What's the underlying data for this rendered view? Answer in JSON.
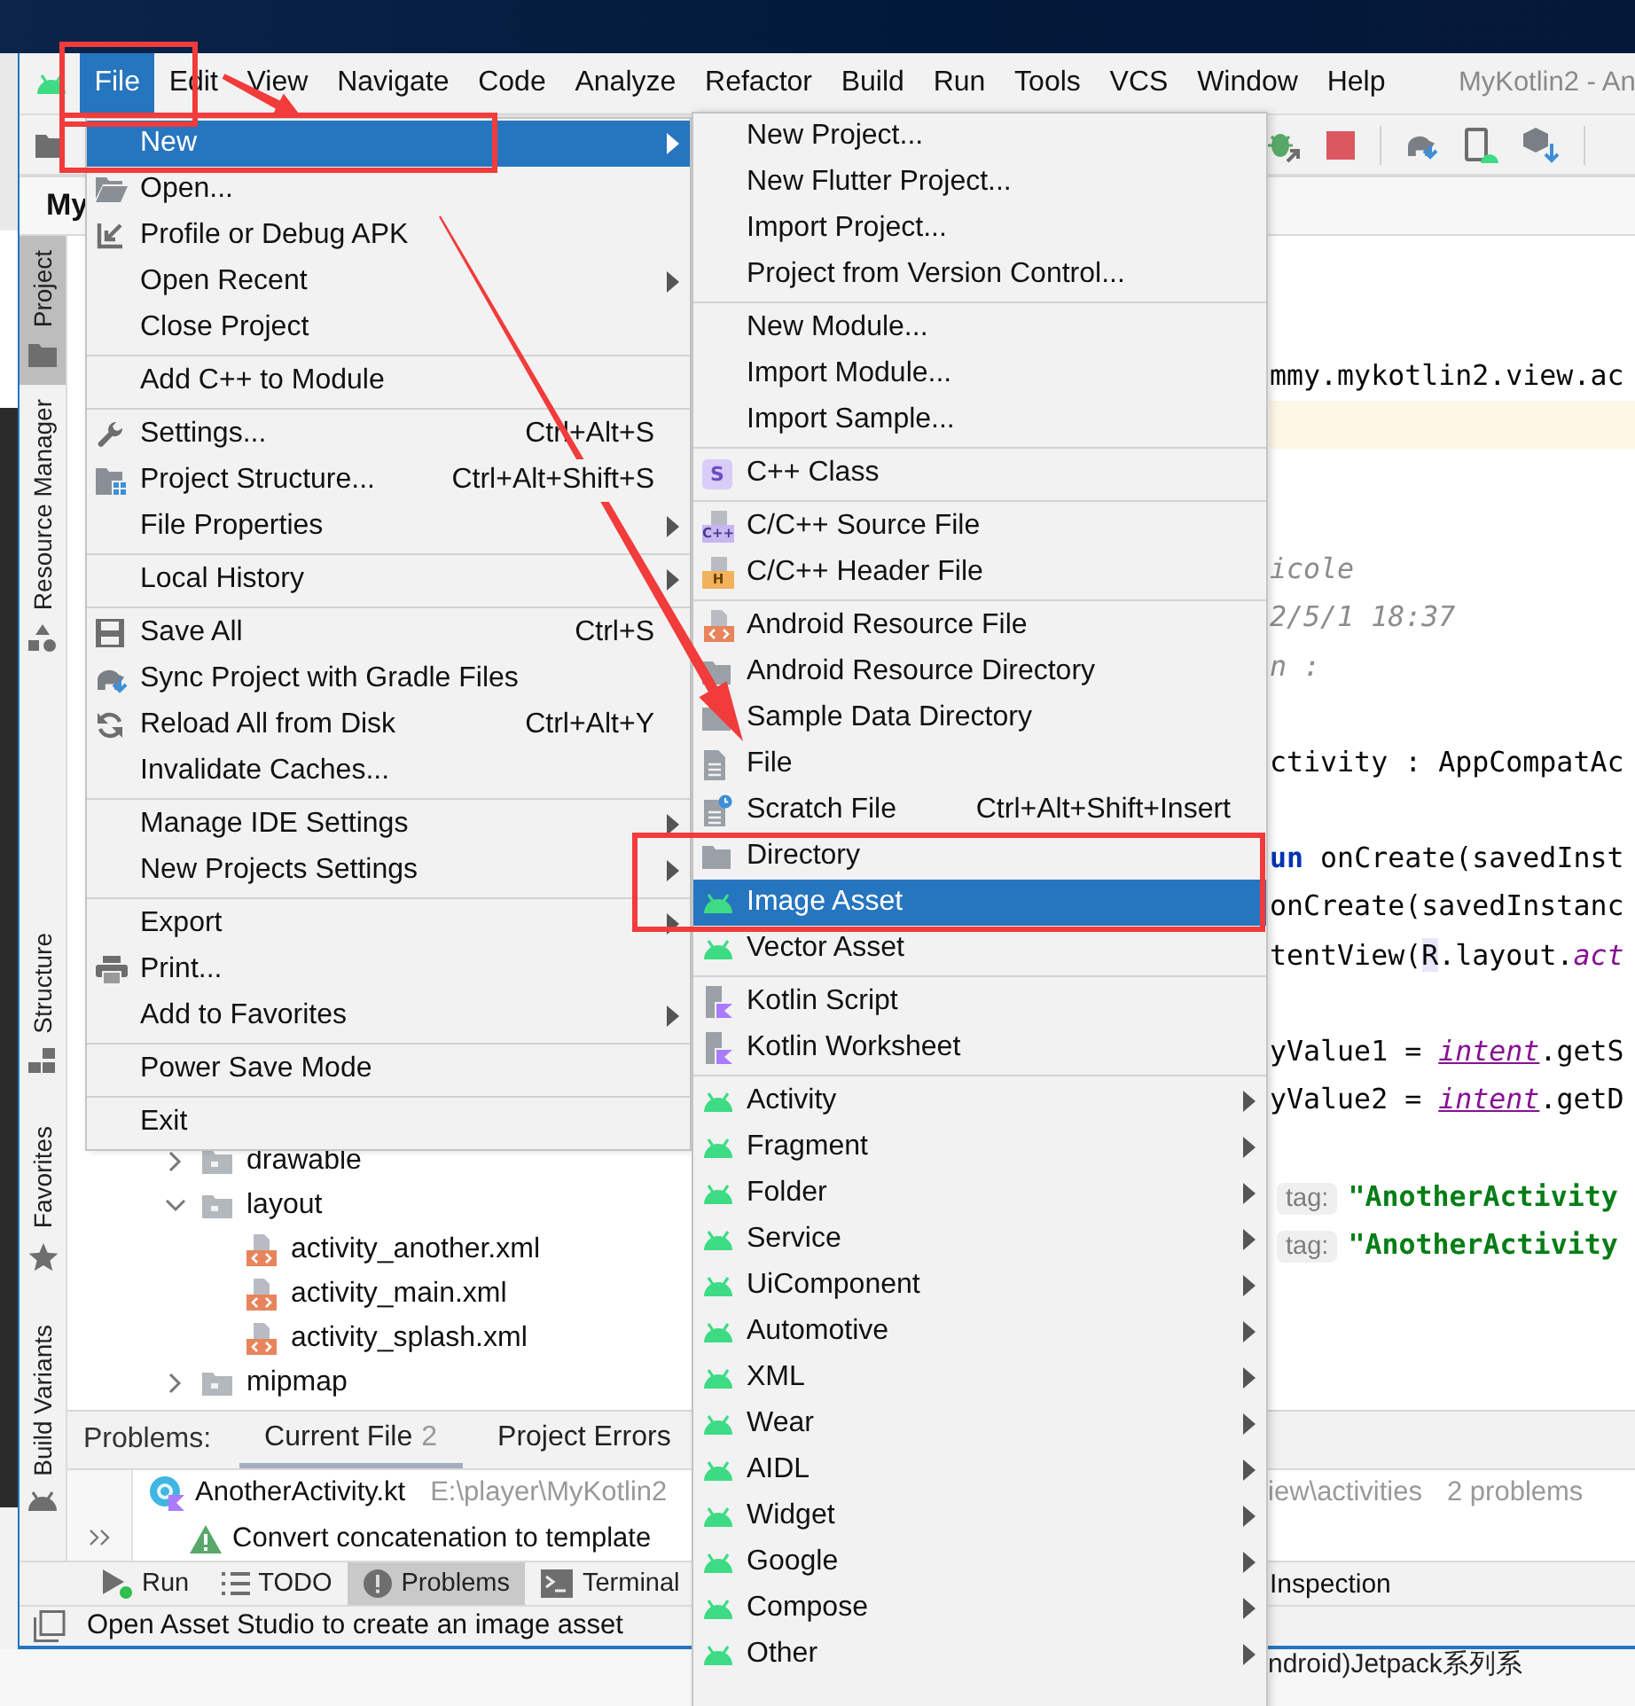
{
  "menubar": {
    "items": [
      {
        "label": "File",
        "selected": true
      },
      {
        "label": "Edit",
        "selected": false
      },
      {
        "label": "View",
        "selected": false
      },
      {
        "label": "Navigate",
        "selected": false
      },
      {
        "label": "Code",
        "selected": false
      },
      {
        "label": "Analyze",
        "selected": false
      },
      {
        "label": "Refactor",
        "selected": false
      },
      {
        "label": "Build",
        "selected": false
      },
      {
        "label": "Run",
        "selected": false
      },
      {
        "label": "Tools",
        "selected": false
      },
      {
        "label": "VCS",
        "selected": false
      },
      {
        "label": "Window",
        "selected": false
      },
      {
        "label": "Help",
        "selected": false
      }
    ],
    "title": "MyKotlin2 - An"
  },
  "project_panel": {
    "title": "My",
    "tree": [
      {
        "label": "drawable",
        "kind": "folder",
        "expanded": false
      },
      {
        "label": "layout",
        "kind": "folder",
        "expanded": true,
        "children": [
          {
            "label": "activity_another.xml",
            "kind": "xml"
          },
          {
            "label": "activity_main.xml",
            "kind": "xml"
          },
          {
            "label": "activity_splash.xml",
            "kind": "xml"
          }
        ]
      },
      {
        "label": "mipmap",
        "kind": "folder",
        "expanded": false
      }
    ]
  },
  "tool_stripe": {
    "top": [
      {
        "label": "Project",
        "kind": "folder",
        "selected": true
      },
      {
        "label": "Resource Manager",
        "kind": "shapes",
        "selected": false
      }
    ],
    "bottom": [
      {
        "label": "Structure",
        "kind": "blocks",
        "selected": false
      },
      {
        "label": "Favorites",
        "kind": "star",
        "selected": false
      },
      {
        "label": "Build Variants",
        "kind": "robot",
        "selected": false
      }
    ]
  },
  "editor": {
    "lines": [
      {
        "kind": "blank",
        "highlighted": false
      },
      {
        "kind": "blank",
        "highlighted": false
      },
      {
        "kind": "code",
        "highlighted": false,
        "segments": [
          {
            "text": "mmy.mykotlin2.view.ac",
            "kind": "plain"
          }
        ]
      },
      {
        "kind": "blank",
        "highlighted": true
      },
      {
        "kind": "blank",
        "highlighted": false
      },
      {
        "kind": "blank",
        "highlighted": false
      },
      {
        "kind": "code",
        "highlighted": false,
        "segments": [
          {
            "text": "icole",
            "kind": "comment"
          }
        ]
      },
      {
        "kind": "code",
        "highlighted": false,
        "segments": [
          {
            "text": "2/5/1 18:37",
            "kind": "comment"
          }
        ]
      },
      {
        "kind": "code",
        "highlighted": false,
        "segments": [
          {
            "text": "n :",
            "kind": "comment"
          }
        ]
      },
      {
        "kind": "blank",
        "highlighted": false
      },
      {
        "kind": "code",
        "highlighted": false,
        "segments": [
          {
            "text": "ctivity : AppCompatAc",
            "kind": "plain"
          }
        ]
      },
      {
        "kind": "blank",
        "highlighted": false
      },
      {
        "kind": "code",
        "highlighted": false,
        "segments": [
          {
            "text": "un",
            "kind": "keyword"
          },
          {
            "text": " onCreate(savedInst",
            "kind": "plain"
          }
        ]
      },
      {
        "kind": "code",
        "highlighted": false,
        "segments": [
          {
            "text": "onCreate(savedInstanc",
            "kind": "plain"
          }
        ]
      },
      {
        "kind": "code",
        "highlighted": false,
        "segments": [
          {
            "text": "tentView(",
            "kind": "plain"
          },
          {
            "text": "R",
            "kind": "symbol"
          },
          {
            "text": ".layout.",
            "kind": "plain"
          },
          {
            "text": "act",
            "kind": "field"
          }
        ]
      },
      {
        "kind": "blank",
        "highlighted": false
      },
      {
        "kind": "code",
        "highlighted": false,
        "segments": [
          {
            "text": "yValue1 = ",
            "kind": "plain"
          },
          {
            "text": "intent",
            "kind": "ref"
          },
          {
            "text": ".getS",
            "kind": "plain"
          }
        ]
      },
      {
        "kind": "code",
        "highlighted": false,
        "segments": [
          {
            "text": "yValue2 = ",
            "kind": "plain"
          },
          {
            "text": "intent",
            "kind": "ref"
          },
          {
            "text": ".getD",
            "kind": "plain"
          }
        ]
      },
      {
        "kind": "blank",
        "highlighted": false
      },
      {
        "kind": "code",
        "highlighted": false,
        "segments": [
          {
            "text": "tag:",
            "kind": "hint"
          },
          {
            "text": "\"AnotherActivity",
            "kind": "string"
          }
        ]
      },
      {
        "kind": "code",
        "highlighted": false,
        "segments": [
          {
            "text": "tag:",
            "kind": "hint"
          },
          {
            "text": "\"AnotherActivity",
            "kind": "string"
          }
        ]
      }
    ]
  },
  "problems": {
    "title": "Problems:",
    "tabs": [
      {
        "label": "Current File",
        "count": "2",
        "selected": true
      },
      {
        "label": "Project Errors",
        "selected": false
      }
    ],
    "file": {
      "name": "AnotherActivity.kt",
      "path": "E:\\player\\MyKotlin2",
      "path_tail": "iew\\activities",
      "summary": "2 problems"
    },
    "warning": "Convert concatenation to template"
  },
  "tool_windows": [
    {
      "label": "Run",
      "kind": "run",
      "selected": false
    },
    {
      "label": "TODO",
      "kind": "list",
      "selected": false
    },
    {
      "label": "Problems",
      "kind": "error",
      "selected": true
    },
    {
      "label": "Terminal",
      "kind": "terminal",
      "selected": false
    }
  ],
  "tool_windows_right": "Inspection",
  "status_bar": "Open Asset Studio to create an image asset",
  "background_text": "ndroid)Jetpack系列系",
  "file_menu": [
    {
      "kind": "plain",
      "label": "New",
      "submenu": true,
      "selected": true
    },
    {
      "kind": "open-folder",
      "label": "Open...",
      "submenu": false,
      "selected": false
    },
    {
      "kind": "corner-arrow",
      "label": "Profile or Debug APK",
      "submenu": false,
      "selected": false
    },
    {
      "kind": "plain",
      "label": "Open Recent",
      "submenu": true,
      "selected": false
    },
    {
      "kind": "plain",
      "label": "Close Project",
      "submenu": false,
      "selected": false
    },
    {
      "kind": "separator"
    },
    {
      "kind": "plain",
      "label": "Add C++ to Module",
      "submenu": false,
      "selected": false
    },
    {
      "kind": "separator"
    },
    {
      "kind": "wrench",
      "label": "Settings...",
      "shortcut": "Ctrl+Alt+S",
      "submenu": false,
      "selected": false
    },
    {
      "kind": "folder-grid",
      "label": "Project Structure...",
      "shortcut": "Ctrl+Alt+Shift+S",
      "submenu": false,
      "selected": false
    },
    {
      "kind": "plain",
      "label": "File Properties",
      "submenu": true,
      "selected": false
    },
    {
      "kind": "separator"
    },
    {
      "kind": "plain",
      "label": "Local History",
      "submenu": true,
      "selected": false
    },
    {
      "kind": "separator"
    },
    {
      "kind": "save",
      "label": "Save All",
      "shortcut": "Ctrl+S",
      "submenu": false,
      "selected": false
    },
    {
      "kind": "elephant",
      "label": "Sync Project with Gradle Files",
      "submenu": false,
      "selected": false
    },
    {
      "kind": "reload",
      "label": "Reload All from Disk",
      "shortcut": "Ctrl+Alt+Y",
      "submenu": false,
      "selected": false
    },
    {
      "kind": "plain",
      "label": "Invalidate Caches...",
      "submenu": false,
      "selected": false
    },
    {
      "kind": "separator"
    },
    {
      "kind": "plain",
      "label": "Manage IDE Settings",
      "submenu": true,
      "selected": false
    },
    {
      "kind": "plain",
      "label": "New Projects Settings",
      "submenu": true,
      "selected": false
    },
    {
      "kind": "separator"
    },
    {
      "kind": "plain",
      "label": "Export",
      "submenu": true,
      "selected": false
    },
    {
      "kind": "printer",
      "label": "Print...",
      "submenu": false,
      "selected": false
    },
    {
      "kind": "plain",
      "label": "Add to Favorites",
      "submenu": true,
      "selected": false
    },
    {
      "kind": "separator"
    },
    {
      "kind": "plain",
      "label": "Power Save Mode",
      "submenu": false,
      "selected": false
    },
    {
      "kind": "separator"
    },
    {
      "kind": "plain",
      "label": "Exit",
      "submenu": false,
      "selected": false
    }
  ],
  "new_submenu": [
    {
      "kind": "plain",
      "label": "New Project...",
      "submenu": false,
      "selected": false
    },
    {
      "kind": "plain",
      "label": "New Flutter Project...",
      "submenu": false,
      "selected": false
    },
    {
      "kind": "plain",
      "label": "Import Project...",
      "submenu": false,
      "selected": false
    },
    {
      "kind": "plain",
      "label": "Project from Version Control...",
      "submenu": false,
      "selected": false
    },
    {
      "kind": "separator"
    },
    {
      "kind": "plain",
      "label": "New Module...",
      "submenu": false,
      "selected": false
    },
    {
      "kind": "plain",
      "label": "Import Module...",
      "submenu": false,
      "selected": false
    },
    {
      "kind": "plain",
      "label": "Import Sample...",
      "submenu": false,
      "selected": false
    },
    {
      "kind": "separator"
    },
    {
      "kind": "cpp-class",
      "icon_text": "S",
      "label": "C++ Class",
      "submenu": false,
      "selected": false
    },
    {
      "kind": "separator"
    },
    {
      "kind": "cpp-source",
      "icon_text": "C++",
      "label": "C/C++ Source File",
      "submenu": false,
      "selected": false
    },
    {
      "kind": "cpp-header",
      "icon_text": "H",
      "label": "C/C++ Header File",
      "submenu": false,
      "selected": false
    },
    {
      "kind": "separator"
    },
    {
      "kind": "xml-file",
      "label": "Android Resource File",
      "submenu": false,
      "selected": false
    },
    {
      "kind": "folder",
      "label": "Android Resource Directory",
      "submenu": false,
      "selected": false
    },
    {
      "kind": "folder",
      "label": "Sample Data Directory",
      "submenu": false,
      "selected": false
    },
    {
      "kind": "doc",
      "label": "File",
      "submenu": false,
      "selected": false
    },
    {
      "kind": "scratch",
      "label": "Scratch File",
      "shortcut": "Ctrl+Alt+Shift+Insert",
      "submenu": false,
      "selected": false
    },
    {
      "kind": "folder",
      "label": "Directory",
      "submenu": false,
      "selected": false
    },
    {
      "kind": "robot",
      "label": "Image Asset",
      "submenu": false,
      "selected": true
    },
    {
      "kind": "robot",
      "label": "Vector Asset",
      "submenu": false,
      "selected": false
    },
    {
      "kind": "separator"
    },
    {
      "kind": "script",
      "label": "Kotlin Script",
      "submenu": false,
      "selected": false
    },
    {
      "kind": "script",
      "label": "Kotlin Worksheet",
      "submenu": false,
      "selected": false
    },
    {
      "kind": "separator"
    },
    {
      "kind": "robot",
      "label": "Activity",
      "submenu": true,
      "selected": false
    },
    {
      "kind": "robot",
      "label": "Fragment",
      "submenu": true,
      "selected": false
    },
    {
      "kind": "robot",
      "label": "Folder",
      "submenu": true,
      "selected": false
    },
    {
      "kind": "robot",
      "label": "Service",
      "submenu": true,
      "selected": false
    },
    {
      "kind": "robot",
      "label": "UiComponent",
      "submenu": true,
      "selected": false
    },
    {
      "kind": "robot",
      "label": "Automotive",
      "submenu": true,
      "selected": false
    },
    {
      "kind": "robot",
      "label": "XML",
      "submenu": true,
      "selected": false
    },
    {
      "kind": "robot",
      "label": "Wear",
      "submenu": true,
      "selected": false
    },
    {
      "kind": "robot",
      "label": "AIDL",
      "submenu": true,
      "selected": false
    },
    {
      "kind": "robot",
      "label": "Widget",
      "submenu": true,
      "selected": false
    },
    {
      "kind": "robot",
      "label": "Google",
      "submenu": true,
      "selected": false
    },
    {
      "kind": "robot",
      "label": "Compose",
      "submenu": true,
      "selected": false
    },
    {
      "kind": "robot",
      "label": "Other",
      "submenu": true,
      "selected": false
    }
  ],
  "annotations": [
    {
      "kind": "box"
    },
    {
      "kind": "arrow"
    },
    {
      "kind": "box"
    },
    {
      "kind": "arrow"
    },
    {
      "kind": "box"
    }
  ]
}
